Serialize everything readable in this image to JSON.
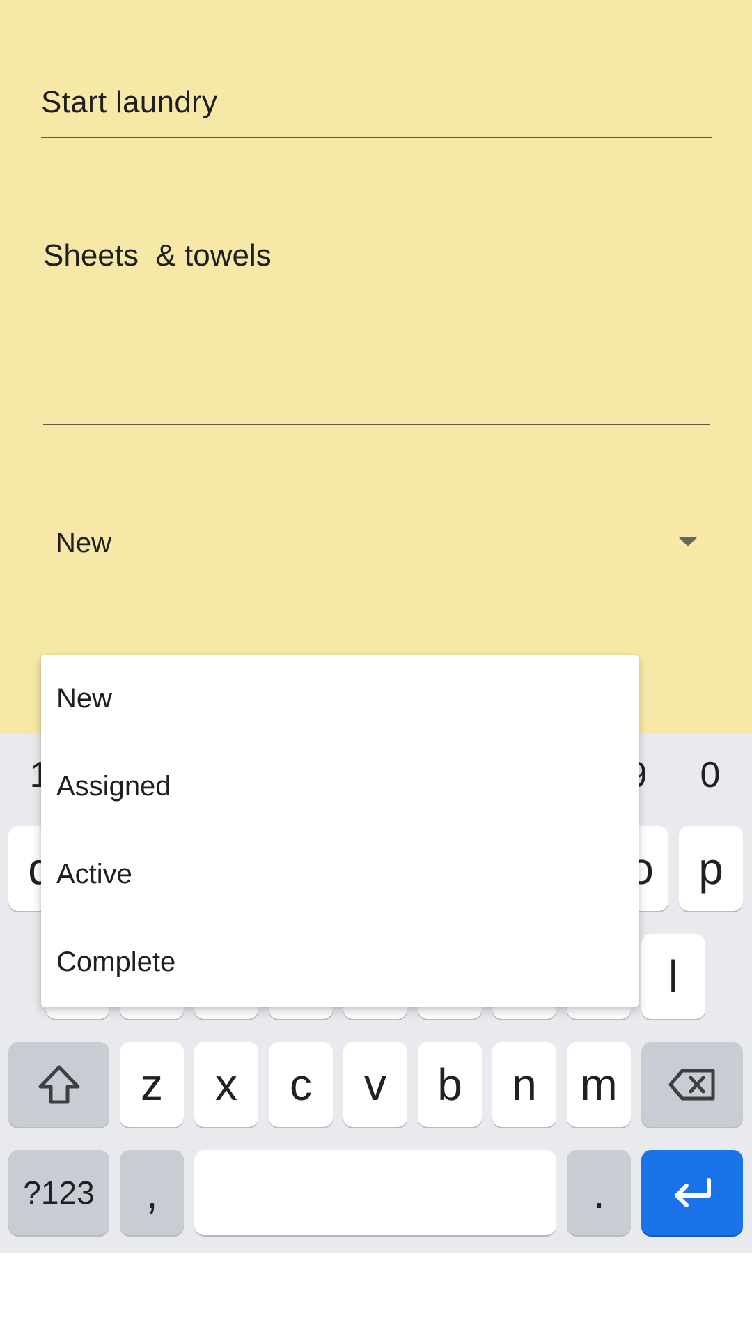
{
  "form": {
    "title_value": "Start laundry",
    "description_value": "Sheets  & towels",
    "status_value": "New"
  },
  "status_menu": {
    "options": [
      "New",
      "Assigned",
      "Active",
      "Complete"
    ]
  },
  "keyboard": {
    "numbers": [
      "1",
      "9",
      "0"
    ],
    "partial_keys": [
      "q",
      "o",
      "p",
      "l"
    ],
    "letters_row3": [
      "z",
      "x",
      "c",
      "v",
      "b",
      "n",
      "m"
    ],
    "symbols_label": "?123",
    "comma": ",",
    "period": ".",
    "icons": [
      "shift-icon",
      "backspace-icon",
      "enter-icon"
    ]
  },
  "colors": {
    "form_background": "#f8e8a8",
    "keyboard_background": "#e8eaed",
    "enter_key": "#1a73e8"
  }
}
